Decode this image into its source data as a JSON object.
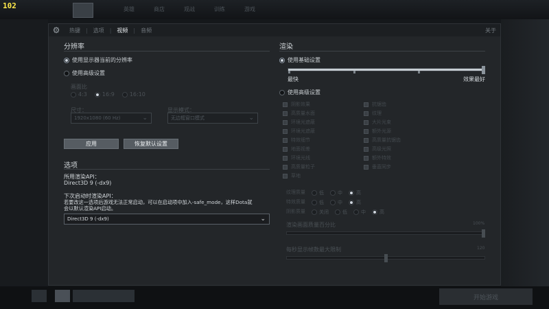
{
  "fps": "102",
  "bg_nav": [
    "英雄",
    "商店",
    "观战",
    "训练",
    "游戏"
  ],
  "bg_play_label": "开始游戏",
  "tabs": [
    "热键",
    "选项",
    "视频",
    "音频"
  ],
  "active_tab": "视频",
  "about": "关于",
  "resolution": {
    "title": "分辨率",
    "use_monitor": "使用显示器当前的分辨率",
    "use_advanced": "使用高级设置",
    "aspect_label": "画面比",
    "aspect_options": [
      "4:3",
      "16:9",
      "16:10"
    ],
    "size_label": "尺寸：",
    "size_value": "1920x1080 (60 Hz)",
    "display_mode_label": "显示模式：",
    "display_mode_value": "无边框窗口模式",
    "apply": "应用",
    "reset": "恢复默认设置"
  },
  "options": {
    "title": "选项",
    "render_api_label": "所用渲染API：",
    "render_api_value": "Direct3D 9 (-dx9)",
    "next_api_label": "下次启动时渲染API：",
    "next_api_note_1": "若要改这一选项后游戏无法正常启动，可以在启动项中加入-safe_mode，这样Dota就",
    "next_api_note_2": "会以默认渲染API启动。",
    "api_select": "Direct3D 9 (-dx9)"
  },
  "rendering": {
    "title": "渲染",
    "use_basic": "使用基础设置",
    "fastest": "最快",
    "best": "效果最好",
    "basic_level": 1.0,
    "use_advanced": "使用高级设置",
    "checks_left": [
      "阴影效果",
      "高质量水面",
      "环境光遮蔽",
      "环境光遮蔽",
      "特效细节",
      "地面视差",
      "环境光线",
      "高质量粒子",
      "草地"
    ],
    "checks_right": [
      "抗锯齿",
      "纹理",
      "大片光束",
      "额外光源",
      "高质量抗锯齿",
      "高级光照",
      "额外特效",
      "垂直同步"
    ],
    "quality_rows": [
      {
        "label": "纹理质量",
        "options": [
          "低",
          "中",
          "高"
        ]
      },
      {
        "label": "特效质量",
        "options": [
          "低",
          "中",
          "高"
        ]
      },
      {
        "label": "阴影质量",
        "options": [
          "关闭",
          "低",
          "中",
          "高"
        ]
      }
    ],
    "slider1_label": "渲染画面质量百分比",
    "slider1_value": "100%",
    "slider1_level": 1.0,
    "slider2_label": "每秒显示帧数最大限制",
    "slider2_value": "120",
    "slider2_level": 0.5
  }
}
